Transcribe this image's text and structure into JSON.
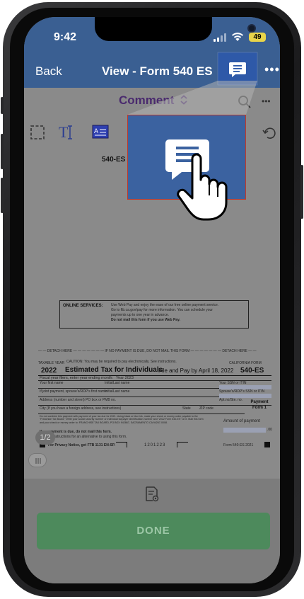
{
  "status": {
    "time": "9:42",
    "battery": "49"
  },
  "navbar": {
    "back_label": "Back",
    "title": "View - Form 540 ES",
    "more_label": "•••"
  },
  "toolbar": {
    "mode_label": "Comment",
    "more_label": "•••"
  },
  "document": {
    "header_label": "540-ES",
    "online_services_label": "ONLINE SERVICES:",
    "online_services_text_1": "Use Web Pay and enjoy the ease of our free online payment service.",
    "online_services_text_2": "Go to ftb.ca.gov/pay for more information. You can schedule your",
    "online_services_text_3": "payments up to one year in advance.",
    "online_services_text_4": "Do not mail this form if you use Web Pay.",
    "detach_line": "— — DETACH HERE — — — — — — —  IF NO PAYMENT IS DUE, DO NOT MAIL THIS FORM  — — — — — — — DETACH HERE — —",
    "taxable_year": "TAXABLE YEAR",
    "caution": "CAUTION: You may be required to pay electronically. See instructions.",
    "california_form": "CALIFORNIA FORM",
    "form_year": "2022",
    "form_title": "Estimated Tax for Individuals",
    "file_and_pay": "File and Pay by April 18, 2022",
    "form_code": "540-ES",
    "fiscal_year": "Fiscal year filers, enter year ending month:",
    "fiscal_year_2": "Year  2023",
    "your_first_name": "Your first name",
    "initial": "Initial",
    "last_name": "Last name",
    "your_ssn": "Your SSN or ITIN",
    "spouse_first_name": "If joint payment, spouse's/RDP's first name",
    "spouse_ssn": "Spouse's/RDP's SSN or ITIN",
    "address": "Address (number and street) PO box or PMB no.",
    "apt": "Apt.no/Ste. no.",
    "city": "City (If you have a foreign address, see instructions)",
    "state": "State",
    "zip": "ZIP code",
    "payment_form": "Payment Form 1",
    "combine_text": "Do not combine this payment with payment of your tax due for 2021. Using black or blue ink, make your check or money order payable to the \"Franchise Tax Board.\" Write your social security number or individual taxpayer identification number and \"2022 Form 540-ES\" on it. Mail this form and your check or money order to: FRANCHISE TAX BOARD, PO BOX 942867, SACRAMENTO CA 94267-0008.",
    "no_payment": "If no payment is due, do not mail this form.",
    "see_instructions": "See the instructions for an alternative to using this form.",
    "amount_of_payment": "Amount of payment",
    "amount_cents": ".00",
    "privacy_notice": "For Privacy Notice, get FTB 1131 EN-SP.",
    "barcode_number": "1201223",
    "footer_form": "Form 540-ES  2021"
  },
  "page_indicator": "1/2",
  "bottom": {
    "done_label": "DONE"
  },
  "colors": {
    "nav_blue": "#3a5f92",
    "accent_blue": "#2e59a8",
    "done_green": "#4d8a5c",
    "highlight_red": "#c0392b"
  }
}
